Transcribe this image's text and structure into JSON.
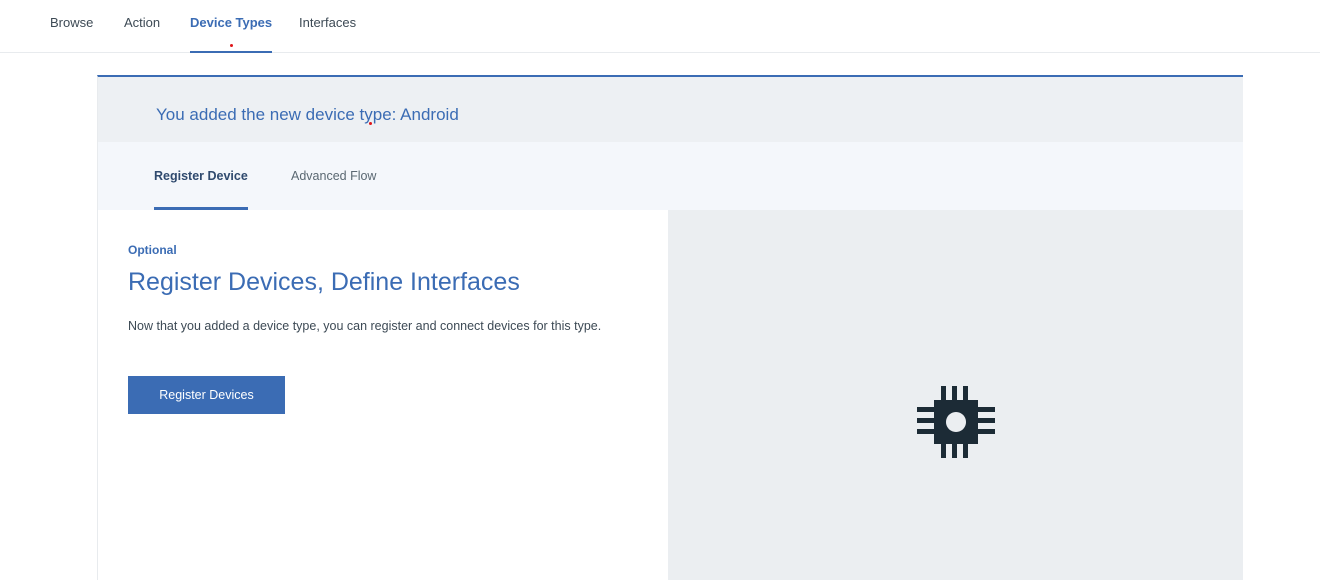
{
  "topnav": {
    "tabs": [
      {
        "label": "Browse"
      },
      {
        "label": "Action"
      },
      {
        "label": "Device Types",
        "active": true
      },
      {
        "label": "Interfaces"
      }
    ]
  },
  "card": {
    "header_title": "You added the new device type: Android",
    "subtabs": [
      {
        "label": "Register Device",
        "active": true
      },
      {
        "label": "Advanced Flow"
      }
    ],
    "optional_label": "Optional",
    "heading": "Register Devices, Define Interfaces",
    "description": "Now that you added a device type, you can register and connect devices for this type.",
    "primary_button": "Register Devices",
    "illustration_icon": "chip-icon"
  },
  "colors": {
    "accent": "#3b6cb4",
    "header_bg": "#edf0f3",
    "subtab_bg": "#f4f7fb",
    "illustration_bg": "#ebeef1",
    "icon_color": "#1c2b36"
  }
}
